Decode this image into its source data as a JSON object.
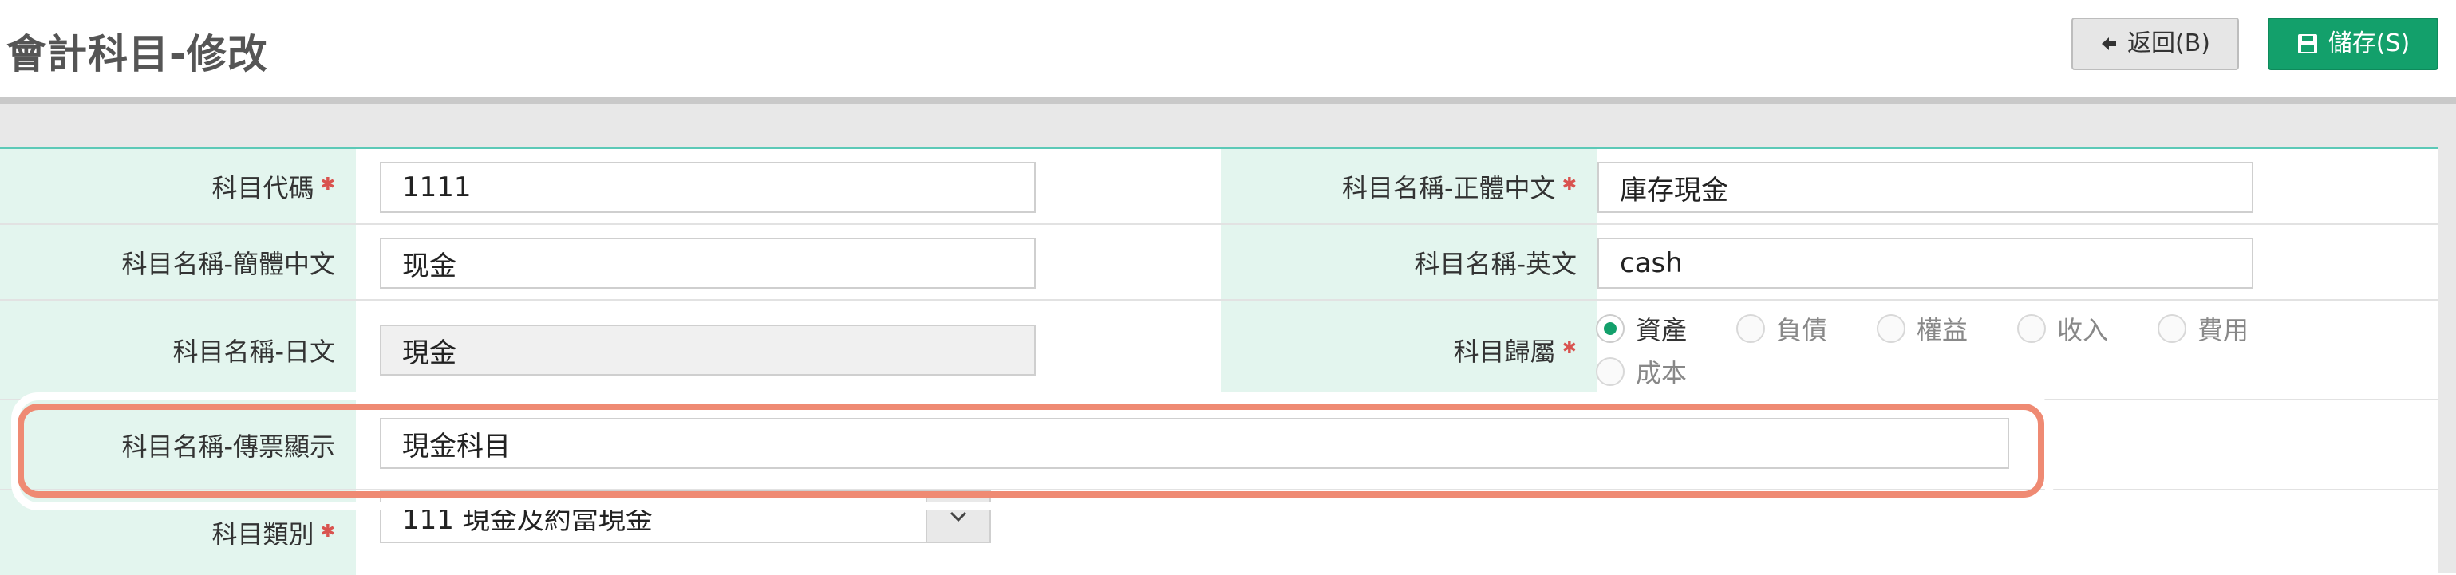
{
  "page": {
    "title": "會計科目-修改"
  },
  "toolbar": {
    "back_label": "返回(B)",
    "save_label": "儲存(S)"
  },
  "colors": {
    "accent": "#13a06b",
    "highlight": "#ef8a73",
    "required": "#d9534f",
    "label_bg": "#e3f5ee"
  },
  "form": {
    "code": {
      "label": "科目代碼",
      "value": "1111",
      "required": true
    },
    "name_trad": {
      "label": "科目名稱-正體中文",
      "value": "庫存現金",
      "required": true
    },
    "name_simp": {
      "label": "科目名稱-簡體中文",
      "value": "现金"
    },
    "name_en": {
      "label": "科目名稱-英文",
      "value": "cash"
    },
    "name_jp": {
      "label": "科目名稱-日文",
      "value": "現金"
    },
    "belong": {
      "label": "科目歸屬",
      "required": true,
      "options": [
        "資產",
        "負債",
        "權益",
        "收入",
        "費用",
        "成本"
      ],
      "selected": "資產"
    },
    "voucher_name": {
      "label": "科目名稱-傳票顯示",
      "value": "現金科目"
    },
    "category": {
      "label": "科目類別",
      "value": "111 現金及約當現金",
      "required": true
    }
  },
  "icons": {
    "back": "arrow-left-icon",
    "save": "floppy-disk-icon",
    "dropdown": "chevron-down-icon"
  }
}
